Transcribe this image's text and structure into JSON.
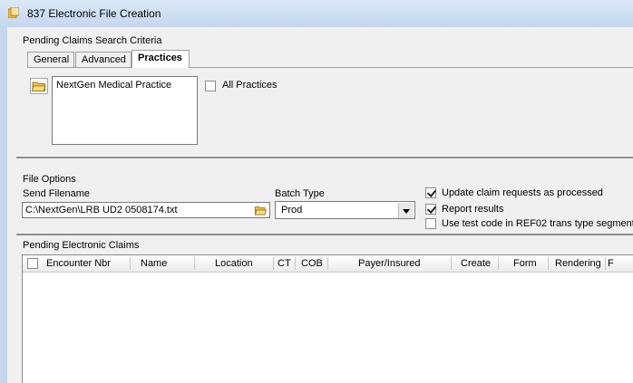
{
  "window": {
    "title": "837 Electronic File Creation",
    "icon": "file-creation-icon"
  },
  "search_criteria": {
    "group_label": "Pending Claims Search Criteria",
    "tabs": [
      {
        "label": "General",
        "active": false
      },
      {
        "label": "Advanced",
        "active": false
      },
      {
        "label": "Practices",
        "active": true
      }
    ],
    "practices": [
      "NextGen Medical Practice"
    ],
    "all_practices": {
      "label": "All Practices",
      "checked": false
    }
  },
  "file_options": {
    "group_label": "File Options",
    "send_filename": {
      "label": "Send Filename",
      "value": "C:\\NextGen\\LRB UD2 0508174.txt"
    },
    "batch_type": {
      "label": "Batch Type",
      "value": "Prod"
    },
    "update_claims": {
      "label": "Update claim requests as processed",
      "checked": true
    },
    "report_results": {
      "label": "Report results",
      "checked": true
    },
    "use_test_code": {
      "label": "Use test code in REF02 trans type segment",
      "checked": false
    }
  },
  "pending_claims": {
    "group_label": "Pending Electronic Claims",
    "columns": [
      "Encounter Nbr",
      "Name",
      "Location",
      "CT",
      "COB",
      "Payer/Insured",
      "Create",
      "Form",
      "Rendering",
      "F"
    ],
    "rows": []
  }
}
